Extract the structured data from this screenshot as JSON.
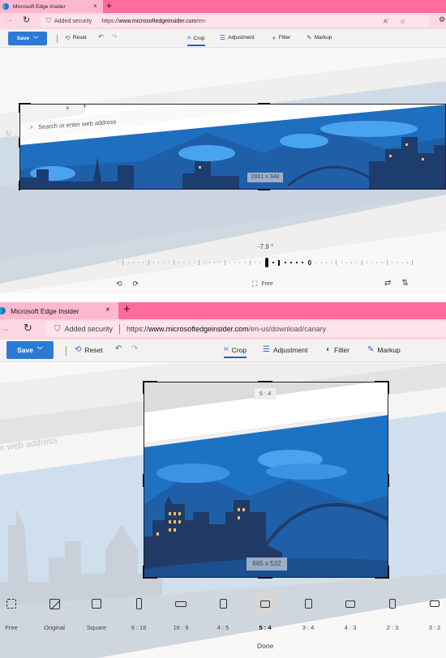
{
  "browser": {
    "tab_title": "Microsoft Edge Insider",
    "close_glyph": "×",
    "new_tab_glyph": "+",
    "security_label": "Added security",
    "url_scheme": "https://",
    "url_host": "www.microsoftedgeinsider.com",
    "url_path": "/en-us/download/canary",
    "colors": {
      "tab_strip": "#ff6b9a",
      "active_tab": "#fdb8cf",
      "address_bar": "#fcd6e2"
    }
  },
  "toolbar": {
    "save_label": "Save",
    "reset_label": "Reset",
    "tabs": [
      {
        "label": "Crop",
        "icon": "crop-icon",
        "active": true
      },
      {
        "label": "Adjustment",
        "icon": "sliders-icon",
        "active": false
      },
      {
        "label": "Filter",
        "icon": "filter-icon",
        "active": false
      },
      {
        "label": "Markup",
        "icon": "pen-icon",
        "active": false
      }
    ],
    "accent": "#2b7bd6"
  },
  "top_panel": {
    "search_placeholder": "Search or enter web address",
    "crop_size": "2001 x 348",
    "rotation_angle": "-7.9 °",
    "rotation_degrees": -7.9,
    "zero_label": "0",
    "free_label": "Free"
  },
  "bottom_panel": {
    "background_text": "er web address",
    "ratio_label": "5 : 4",
    "crop_size": "665 x 532",
    "aspect_ratios": [
      {
        "label": "Free",
        "icon": "free-crop-icon",
        "selected": false
      },
      {
        "label": "Original",
        "icon": "image-icon",
        "selected": false
      },
      {
        "label": "Square",
        "icon": "square-icon",
        "selected": false
      },
      {
        "label": "9 : 16",
        "icon": "portrait-ratio-icon",
        "selected": false
      },
      {
        "label": "16 : 9",
        "icon": "landscape-ratio-icon",
        "selected": false
      },
      {
        "label": "4 : 5",
        "icon": "portrait-ratio-icon",
        "selected": false
      },
      {
        "label": "5 : 4",
        "icon": "landscape-ratio-icon",
        "selected": true
      },
      {
        "label": "3 : 4",
        "icon": "portrait-ratio-icon",
        "selected": false
      },
      {
        "label": "4 : 3",
        "icon": "landscape-ratio-icon",
        "selected": false
      },
      {
        "label": "2 : 3",
        "icon": "portrait-ratio-icon",
        "selected": false
      },
      {
        "label": "3 : 2",
        "icon": "landscape-ratio-icon",
        "selected": false
      }
    ],
    "done_label": "Done"
  }
}
